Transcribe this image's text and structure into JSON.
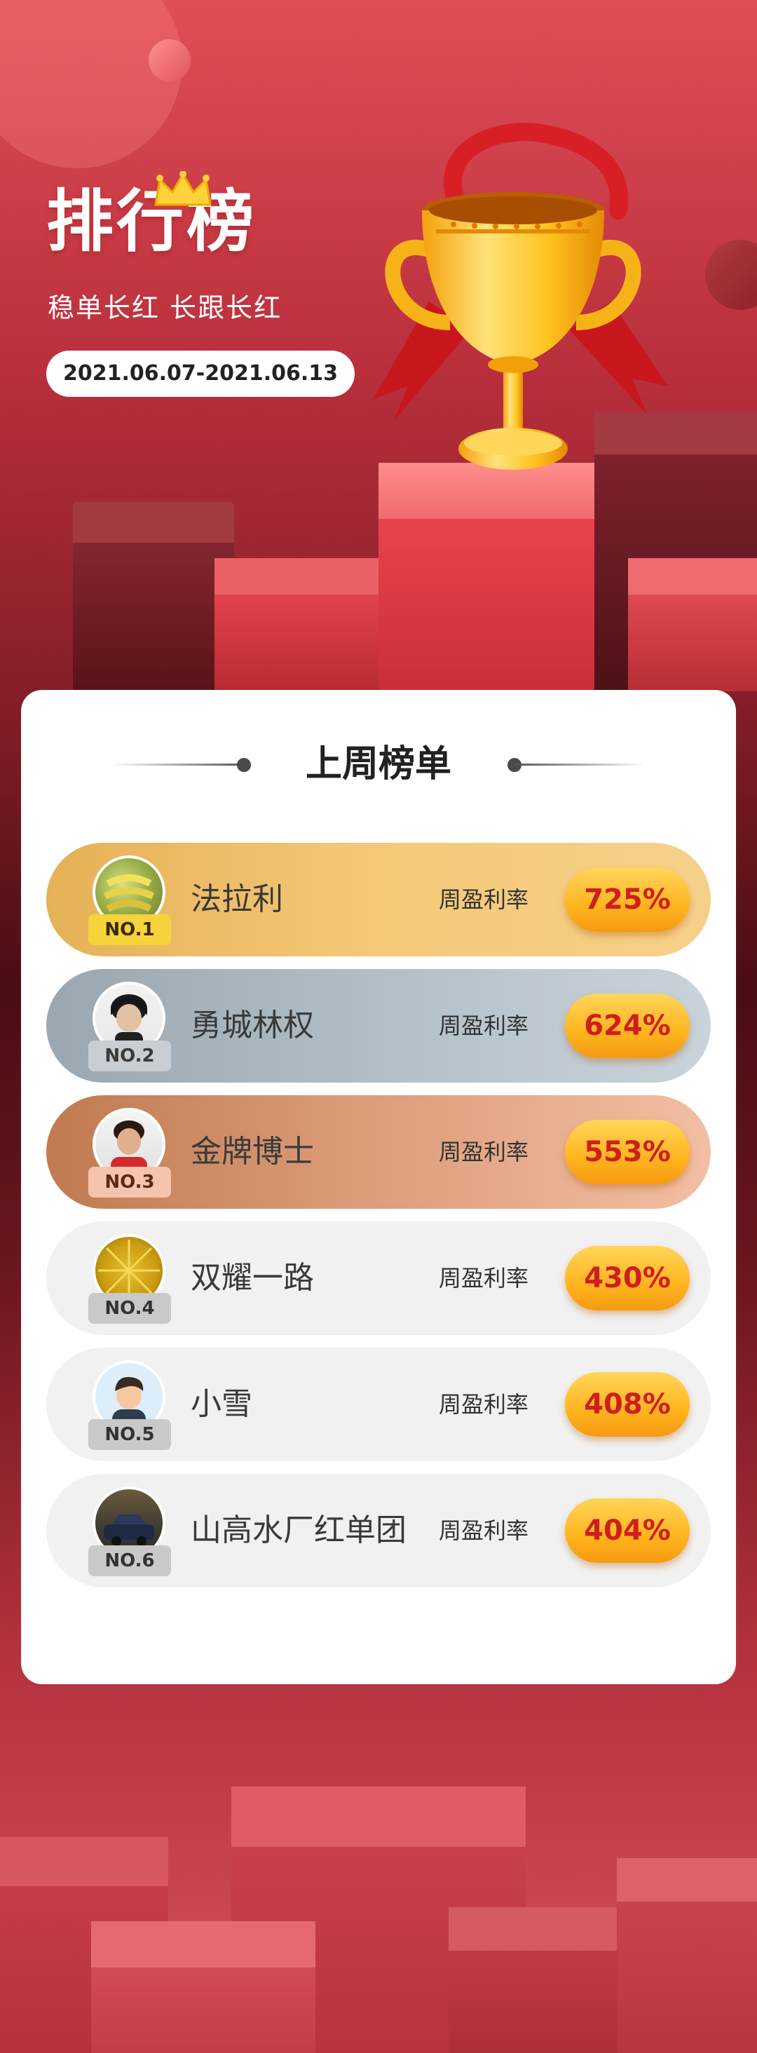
{
  "header": {
    "title": "排行榜",
    "subtitle": "稳单长红 长跟长红",
    "date_range": "2021.06.07-2021.06.13"
  },
  "section": {
    "title": "上周榜单"
  },
  "ranking": [
    {
      "rank": "NO.1",
      "name": "法拉利",
      "rate_label": "周盈利率",
      "rate": "725%"
    },
    {
      "rank": "NO.2",
      "name": "勇城林权",
      "rate_label": "周盈利率",
      "rate": "624%"
    },
    {
      "rank": "NO.3",
      "name": "金牌博士",
      "rate_label": "周盈利率",
      "rate": "553%"
    },
    {
      "rank": "NO.4",
      "name": "双耀一路",
      "rate_label": "周盈利率",
      "rate": "430%"
    },
    {
      "rank": "NO.5",
      "name": "小雪",
      "rate_label": "周盈利率",
      "rate": "408%"
    },
    {
      "rank": "NO.6",
      "name": "山高水厂红单团",
      "rate_label": "周盈利率",
      "rate": "404%"
    }
  ],
  "colors": {
    "gold_row": "#f4c978",
    "silver_row": "#b7c3cb",
    "bronze_row": "#dd9e7b",
    "plain_row": "#f1f1f1",
    "rate_text": "#d01e1e"
  }
}
